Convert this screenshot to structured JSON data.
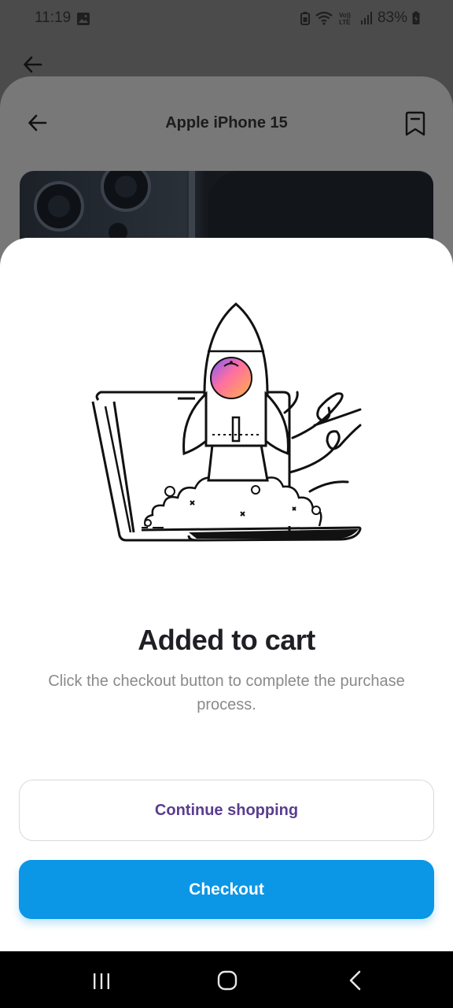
{
  "status": {
    "time": "11:19",
    "battery": "83%"
  },
  "product": {
    "title": "Apple iPhone 15"
  },
  "modal": {
    "title": "Added to cart",
    "description": "Click the checkout button to complete the purchase process.",
    "continue_label": "Continue shopping",
    "checkout_label": "Checkout"
  },
  "colors": {
    "primary": "#0b96e6",
    "secondary_text": "#5a3d8f"
  },
  "icons": {
    "outer_back": "arrow-left-icon",
    "header_back": "arrow-left-icon",
    "bookmark": "bookmark-icon",
    "nav_recents": "recents-icon",
    "nav_home": "home-icon",
    "nav_back": "back-chevron-icon"
  }
}
